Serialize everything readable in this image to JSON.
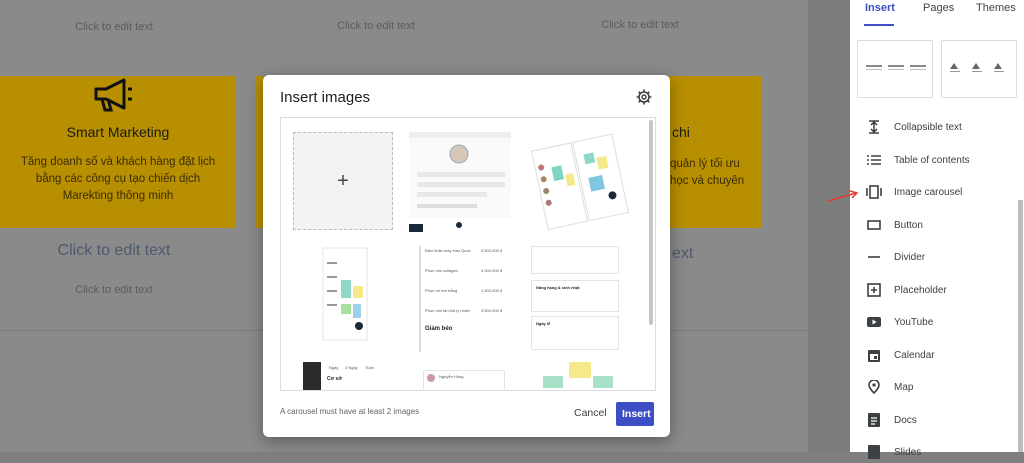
{
  "canvas": {
    "click_to_edit": "Click to edit text",
    "card_left": {
      "title": "Smart Marketing",
      "text_lines": [
        "Tăng doanh số và khách hàng đặt lịch",
        "bằng các công cụ tạo chiến dịch",
        "Marekting thông minh"
      ]
    },
    "card_right": {
      "title_fragment": "chi",
      "text_lines": [
        "quản lý tối ưu",
        "học và chuyên"
      ]
    },
    "big_cte": "Click to edit text",
    "big_cte_right_fragment": "ext"
  },
  "panel": {
    "tabs": [
      "Insert",
      "Pages",
      "Themes"
    ],
    "items": [
      {
        "label": "Collapsible text",
        "icon": "collapsible-text-icon"
      },
      {
        "label": "Table of contents",
        "icon": "list-icon"
      },
      {
        "label": "Image carousel",
        "icon": "carousel-icon"
      },
      {
        "label": "Button",
        "icon": "button-icon"
      },
      {
        "label": "Divider",
        "icon": "divider-icon"
      },
      {
        "label": "Placeholder",
        "icon": "placeholder-icon"
      },
      {
        "label": "YouTube",
        "icon": "youtube-icon"
      },
      {
        "label": "Calendar",
        "icon": "calendar-icon"
      },
      {
        "label": "Map",
        "icon": "map-pin-icon"
      },
      {
        "label": "Docs",
        "icon": "docs-icon"
      },
      {
        "label": "Slides",
        "icon": "slides-icon"
      }
    ]
  },
  "modal": {
    "title": "Insert images",
    "footer_note": "A carousel must have at least 2 images",
    "cancel_label": "Cancel",
    "insert_label": "Insert",
    "thumbs": {
      "t2_row1": "Điều khắc máy Hàn Quốc",
      "t2_price1": "3.500.000 đ",
      "t2_row2": "Phun mồi collagen",
      "t2_price2": "3.000.000 đ",
      "t2_row3": "Phun mí mờ trắng",
      "t2_price3": "1.500.000 đ",
      "t2_row4": "Phun môi tán bột ly nhiên",
      "t2_price4": "3.500.000 đ",
      "t2_section": "Giảm béo",
      "t3_item1": "Nâng hạng & sinh nhật",
      "t3_item2": "Ngày lễ",
      "t4_tab1": "Ngày",
      "t4_tab2": "3 Ngày",
      "t4_tab3": "Tuần",
      "t4_label": "Cơ sở",
      "t5_name": "Nguyễn Hùng"
    }
  },
  "colors": {
    "accent": "#3c4fc4",
    "card": "#b88f00",
    "arrow": "#e53935"
  }
}
